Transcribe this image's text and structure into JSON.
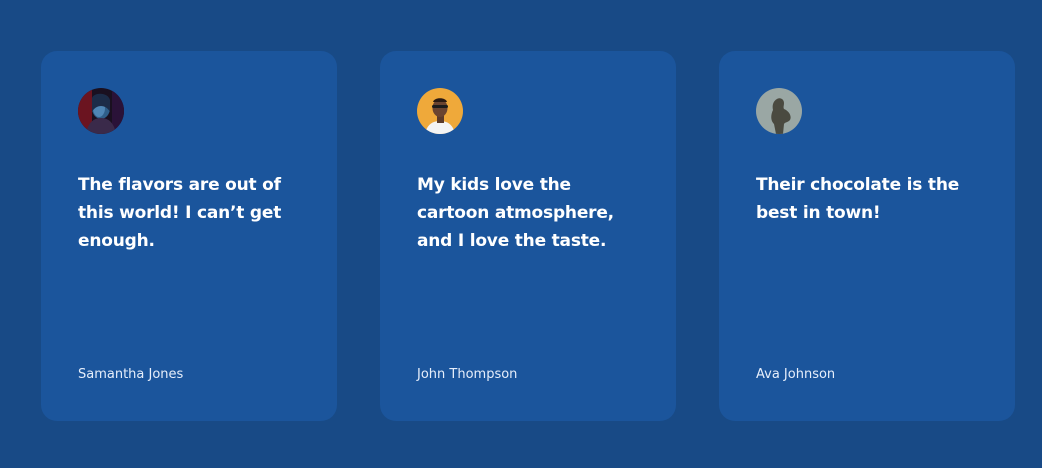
{
  "testimonials": [
    {
      "avatar_icon": "woman-portrait-neon-icon",
      "quote": "The flavors are out of this world! I can’t get enough.",
      "author": "Samantha Jones"
    },
    {
      "avatar_icon": "man-portrait-orange-icon",
      "quote": "My kids love the cartoon atmosphere, and I love the taste.",
      "author": "John Thompson"
    },
    {
      "avatar_icon": "woman-silhouette-icon",
      "quote": "Their chocolate is the best in town!",
      "author": "Ava Johnson"
    }
  ],
  "colors": {
    "page_background": "#184a86",
    "card_background": "#1b559c",
    "text": "#ffffff"
  }
}
